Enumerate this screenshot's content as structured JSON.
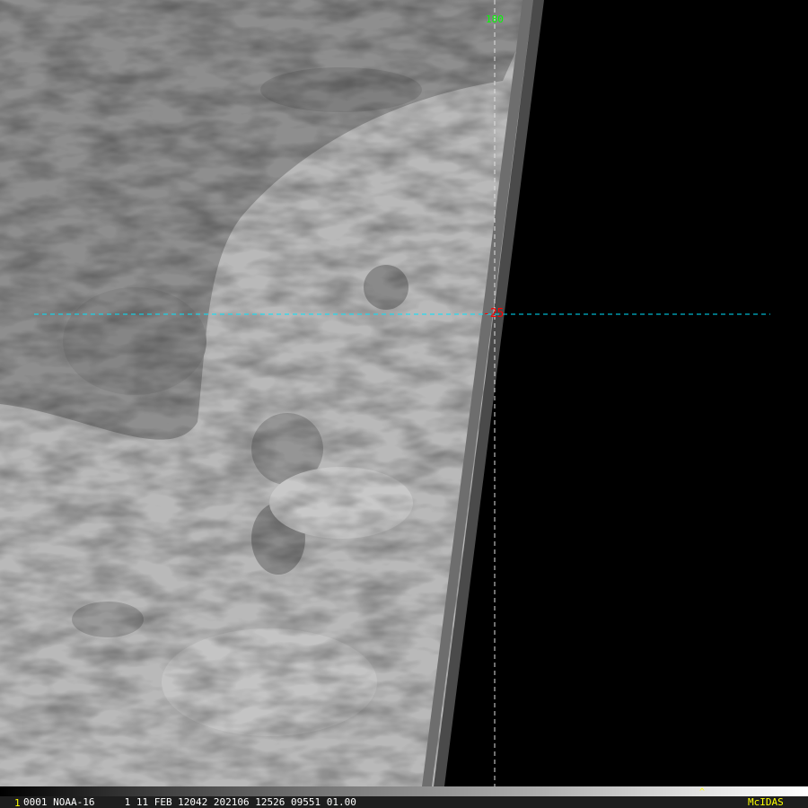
{
  "overlay": {
    "longitude_label": "180",
    "latitude_label": "-25",
    "longitude_color": "#00ff00",
    "latitude_color": "#ff0000",
    "gridline_color": "#00e5ff"
  },
  "status_bar": {
    "frame_number": "1",
    "text": "0001 NOAA-16     1 11 FEB 12042 202106 12526 09551 01.00",
    "brand": "McIDAS",
    "cursor_symbol": "^"
  }
}
